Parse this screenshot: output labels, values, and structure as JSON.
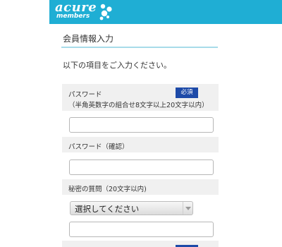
{
  "header": {
    "logo_main": "acure",
    "logo_sub": "members",
    "bg_color": "#1faed4"
  },
  "page": {
    "title": "会員情報入力",
    "intro": "以下の項目をご入力ください。"
  },
  "form": {
    "password": {
      "label": "パスワード",
      "note": "（半角英数字の組合せ8文字以上20文字以内）",
      "required_badge": "必須",
      "value": ""
    },
    "password_confirm": {
      "label": "パスワード（確認）",
      "value": ""
    },
    "secret_question": {
      "label": "秘密の質問（20文字以内)",
      "select_value": "選択してください",
      "answer_value": ""
    }
  },
  "colors": {
    "accent": "#1faed4",
    "badge": "#1d4aa8",
    "label_band": "#f0f0f0"
  }
}
